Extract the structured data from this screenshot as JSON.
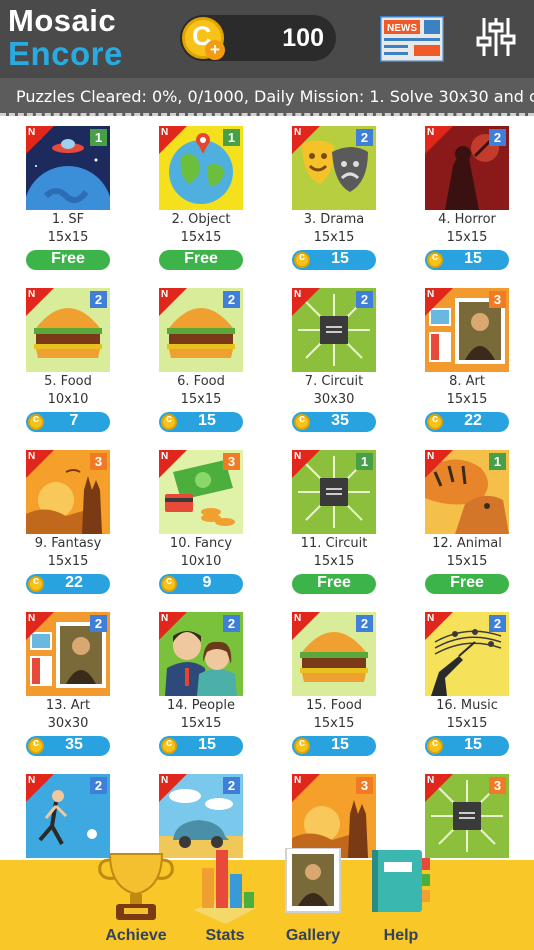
{
  "app": {
    "title_line1": "Mosaic",
    "title_line2": "Encore"
  },
  "header": {
    "coins": "100",
    "news_label": "NEWS"
  },
  "ticker": {
    "text": "Puzzles Cleared: 0%, 0/1000,   Daily Mission:  1. Solve 30x30 and c"
  },
  "puzzles": [
    {
      "name": "1. SF",
      "size": "15x15",
      "price": "Free",
      "badge": "1",
      "new": "N"
    },
    {
      "name": "2. Object",
      "size": "15x15",
      "price": "Free",
      "badge": "1",
      "new": "N"
    },
    {
      "name": "3. Drama",
      "size": "15x15",
      "price": "15",
      "badge": "2",
      "new": "N"
    },
    {
      "name": "4. Horror",
      "size": "15x15",
      "price": "15",
      "badge": "2",
      "new": "N"
    },
    {
      "name": "5. Food",
      "size": "10x10",
      "price": "7",
      "badge": "2",
      "new": "N"
    },
    {
      "name": "6. Food",
      "size": "15x15",
      "price": "15",
      "badge": "2",
      "new": "N"
    },
    {
      "name": "7. Circuit",
      "size": "30x30",
      "price": "35",
      "badge": "2",
      "new": "N"
    },
    {
      "name": "8. Art",
      "size": "15x15",
      "price": "22",
      "badge": "3",
      "new": "N"
    },
    {
      "name": "9. Fantasy",
      "size": "15x15",
      "price": "22",
      "badge": "3",
      "new": "N"
    },
    {
      "name": "10. Fancy",
      "size": "10x10",
      "price": "9",
      "badge": "3",
      "new": "N"
    },
    {
      "name": "11. Circuit",
      "size": "15x15",
      "price": "Free",
      "badge": "1",
      "new": "N"
    },
    {
      "name": "12. Animal",
      "size": "15x15",
      "price": "Free",
      "badge": "1",
      "new": "N"
    },
    {
      "name": "13. Art",
      "size": "30x30",
      "price": "35",
      "badge": "2",
      "new": "N"
    },
    {
      "name": "14. People",
      "size": "15x15",
      "price": "15",
      "badge": "2",
      "new": "N"
    },
    {
      "name": "15. Food",
      "size": "15x15",
      "price": "15",
      "badge": "2",
      "new": "N"
    },
    {
      "name": "16. Music",
      "size": "15x15",
      "price": "15",
      "badge": "2",
      "new": "N"
    },
    {
      "name": "",
      "size": "",
      "price": "",
      "badge": "2",
      "new": "N"
    },
    {
      "name": "",
      "size": "",
      "price": "",
      "badge": "2",
      "new": "N"
    },
    {
      "name": "",
      "size": "",
      "price": "",
      "badge": "3",
      "new": "N"
    },
    {
      "name": "",
      "size": "",
      "price": "",
      "badge": "3",
      "new": "N"
    }
  ],
  "nav": {
    "achieve": "Achieve",
    "stats": "Stats",
    "gallery": "Gallery",
    "help": "Help"
  },
  "colors": {
    "header_bg": "#4a4a4a",
    "logo_blue": "#29abe2",
    "free_green": "#3cb44a",
    "price_blue": "#29a3e0",
    "coin_gold": "#f7c21a",
    "bottom_yellow": "#f9c728"
  }
}
